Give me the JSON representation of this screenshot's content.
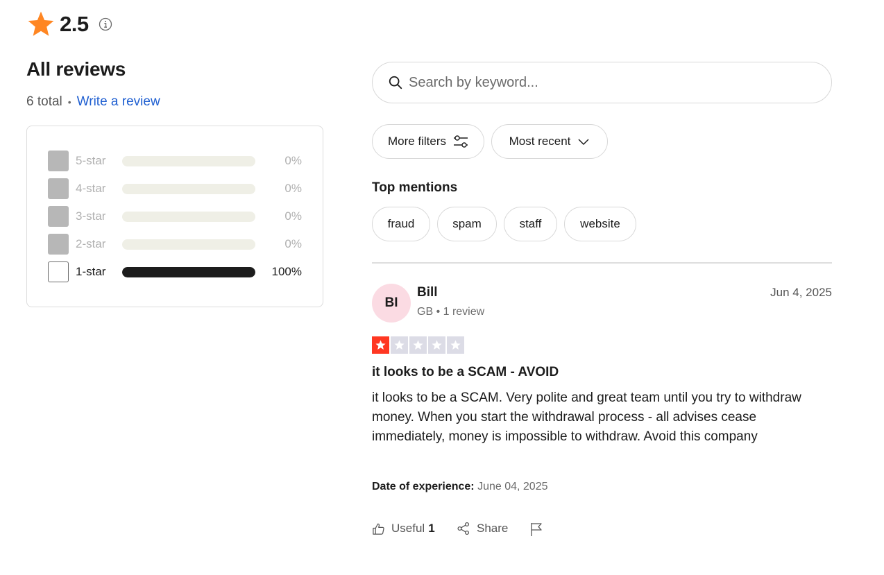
{
  "rating": {
    "value": "2.5",
    "star_color": "#ff8622"
  },
  "header": {
    "title": "All reviews",
    "total": "6 total",
    "write_review": "Write a review"
  },
  "distribution": [
    {
      "label": "5-star",
      "percent_text": "0%",
      "percent": 0,
      "active": false
    },
    {
      "label": "4-star",
      "percent_text": "0%",
      "percent": 0,
      "active": false
    },
    {
      "label": "3-star",
      "percent_text": "0%",
      "percent": 0,
      "active": false
    },
    {
      "label": "2-star",
      "percent_text": "0%",
      "percent": 0,
      "active": false
    },
    {
      "label": "1-star",
      "percent_text": "100%",
      "percent": 100,
      "active": true
    }
  ],
  "search": {
    "placeholder": "Search by keyword..."
  },
  "filters": {
    "more_filters": "More filters",
    "sort": "Most recent"
  },
  "top_mentions": {
    "title": "Top mentions",
    "tags": [
      "fraud",
      "spam",
      "staff",
      "website"
    ]
  },
  "review": {
    "initials": "BI",
    "name": "Bill",
    "meta": "GB • 1 review",
    "date": "Jun 4, 2025",
    "stars": 1,
    "star_color": "#ff3722",
    "title": "it looks to be a SCAM - AVOID",
    "body": "it looks to be a SCAM. Very polite and great team until you try to withdraw money. When you start the withdrawal process - all advises cease immediately, money is impossible to withdraw. Avoid this company",
    "experience_label": "Date of experience:",
    "experience_date": "June 04, 2025",
    "useful_label": "Useful",
    "useful_count": "1",
    "share_label": "Share"
  }
}
